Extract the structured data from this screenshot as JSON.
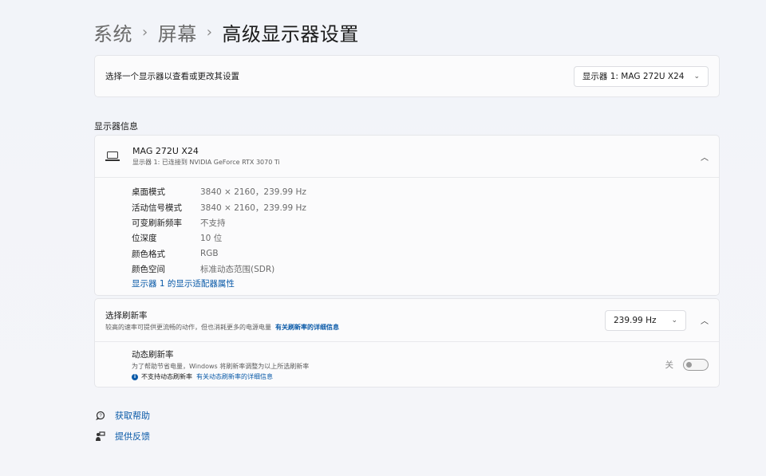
{
  "breadcrumb": {
    "items": [
      "系统",
      "屏幕"
    ],
    "separator": "›",
    "current": "高级显示器设置"
  },
  "selector": {
    "label": "选择一个显示器以查看或更改其设置",
    "value": "显示器 1: MAG 272U X24"
  },
  "section_title": "显示器信息",
  "display_info": {
    "name": "MAG 272U X24",
    "subtitle": "显示器 1: 已连接到 NVIDIA GeForce RTX 3070 Ti",
    "rows": [
      {
        "key": "桌面模式",
        "value": "3840 × 2160，239.99 Hz"
      },
      {
        "key": "活动信号模式",
        "value": "3840 × 2160，239.99 Hz"
      },
      {
        "key": "可变刷新频率",
        "value": "不支持"
      },
      {
        "key": "位深度",
        "value": "10 位"
      },
      {
        "key": "颜色格式",
        "value": "RGB"
      },
      {
        "key": "颜色空间",
        "value": "标准动态范围(SDR)"
      }
    ],
    "adapter_link": "显示器 1 的显示适配器属性"
  },
  "refresh": {
    "title": "选择刷新率",
    "desc": "较高的速率可提供更流畅的动作，但也消耗更多的电源电量",
    "link": "有关刷新率的详细信息",
    "value": "239.99 Hz",
    "dynamic": {
      "title": "动态刷新率",
      "desc": "为了帮助节省电量，Windows 将刷新率调整为以上所选刷新率",
      "note": "不支持动态刷新率",
      "note_link": "有关动态刷新率的详细信息",
      "toggle_label": "关",
      "toggle_on": false
    }
  },
  "help": {
    "get_help": "获取帮助",
    "feedback": "提供反馈"
  },
  "colors": {
    "accent": "#0a5aa8",
    "background": "#f3f5f9",
    "card": "#fbfbfc"
  }
}
